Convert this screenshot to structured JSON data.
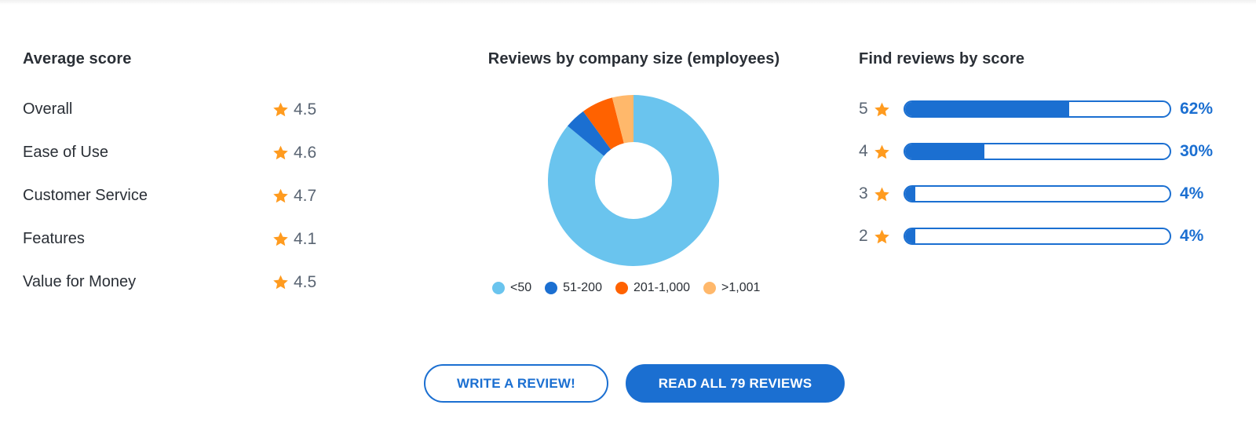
{
  "average_score": {
    "title": "Average score",
    "items": [
      {
        "label": "Overall",
        "score": "4.5"
      },
      {
        "label": "Ease of Use",
        "score": "4.6"
      },
      {
        "label": "Customer Service",
        "score": "4.7"
      },
      {
        "label": "Features",
        "score": "4.1"
      },
      {
        "label": "Value for Money",
        "score": "4.5"
      }
    ]
  },
  "company_size": {
    "title": "Reviews by company size (employees)"
  },
  "chart_data": {
    "type": "pie",
    "title": "Reviews by company size (employees)",
    "donut": true,
    "categories": [
      "<50",
      "51-200",
      "201-1,000",
      ">1,001"
    ],
    "values": [
      86,
      4,
      6,
      4
    ],
    "units": "percent of reviews (estimated)",
    "colors": [
      "#6ac4ee",
      "#1b6fd1",
      "#ff6200",
      "#ffb86b"
    ],
    "start_angle": "12 o'clock, clockwise",
    "legend_position": "bottom"
  },
  "find_by_score": {
    "title": "Find reviews by score",
    "rows": [
      {
        "stars": "5",
        "percent": 62,
        "label": "62%"
      },
      {
        "stars": "4",
        "percent": 30,
        "label": "30%"
      },
      {
        "stars": "3",
        "percent": 4,
        "label": "4%"
      },
      {
        "stars": "2",
        "percent": 4,
        "label": "4%"
      }
    ]
  },
  "buttons": {
    "write_review": "WRITE A REVIEW!",
    "read_all": "READ ALL 79 REVIEWS"
  },
  "colors": {
    "accent": "#1b6fd1",
    "star": "#ff9b1f",
    "text": "#2a2f36",
    "muted": "#5a6573"
  }
}
